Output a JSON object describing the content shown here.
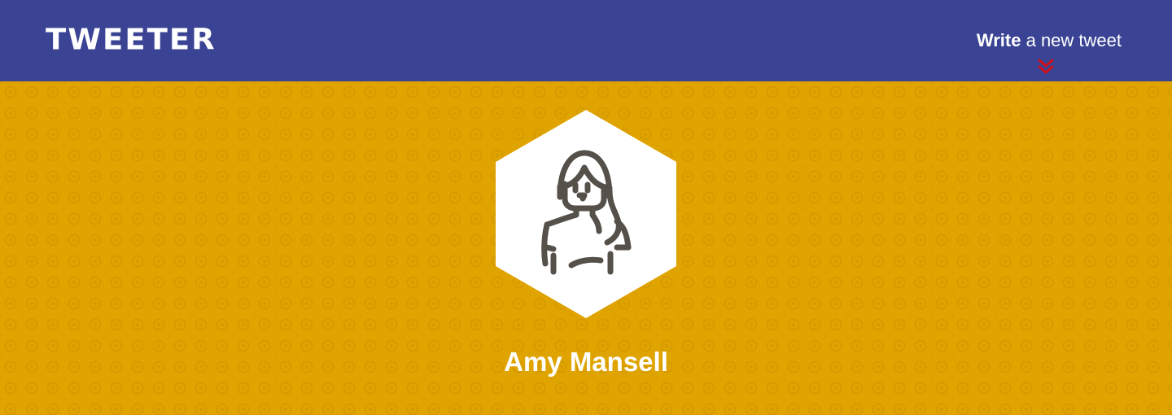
{
  "navbar": {
    "brand": "TWEETER",
    "write_strong": "Write",
    "write_rest": " a new tweet",
    "chevron_icon": "double-chevron-down-icon",
    "background_color": "#3b4494",
    "chevron_color": "#d0121b"
  },
  "profile": {
    "name": "Amy Mansell",
    "avatar_icon": "woman-user-avatar-icon",
    "background_color": "#e0a400"
  }
}
